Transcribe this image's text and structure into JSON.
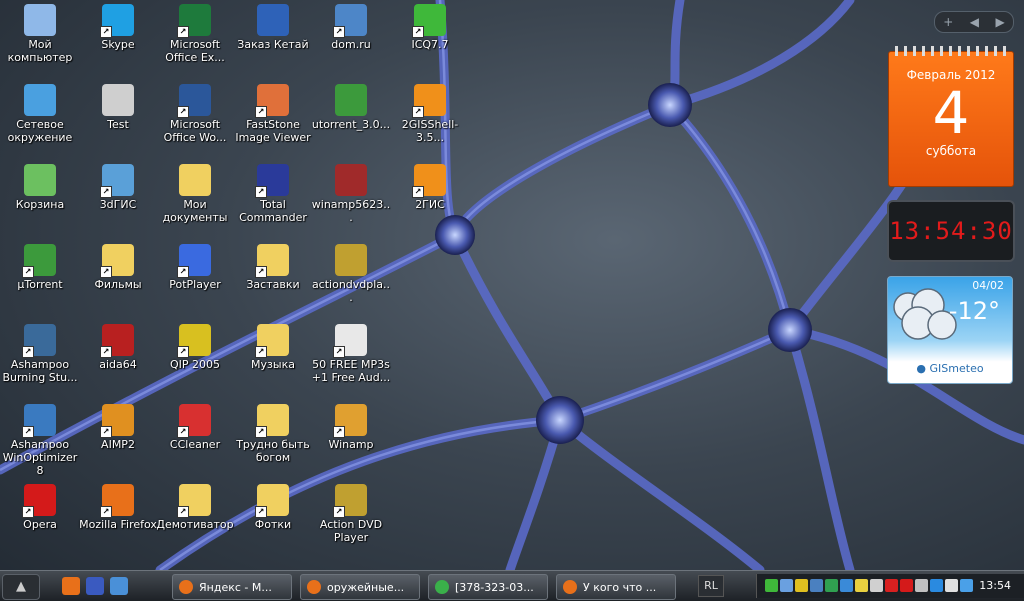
{
  "desktop": {
    "icons": [
      {
        "id": "my-computer",
        "label": "Мой компьютер",
        "icon": "computer-icon",
        "color": "#8fb8e8",
        "col": 0,
        "row": 0,
        "shortcut": false
      },
      {
        "id": "skype",
        "label": "Skype",
        "icon": "skype-icon",
        "color": "#1fa0e3",
        "col": 1,
        "row": 0,
        "shortcut": true
      },
      {
        "id": "excel",
        "label": "Microsoft Office Ex...",
        "icon": "excel-icon",
        "color": "#1e7a3c",
        "col": 2,
        "row": 0,
        "shortcut": true
      },
      {
        "id": "zakaz",
        "label": "Заказ Кетай",
        "icon": "word-doc-icon",
        "color": "#2e62b8",
        "col": 3,
        "row": 0,
        "shortcut": false
      },
      {
        "id": "domru",
        "label": "dom.ru",
        "icon": "network-globe-icon",
        "color": "#4d86c8",
        "col": 4,
        "row": 0,
        "shortcut": true
      },
      {
        "id": "icq",
        "label": "ICQ7.7",
        "icon": "icq-flower-icon",
        "color": "#3fb83a",
        "col": 5,
        "row": 0,
        "shortcut": true
      },
      {
        "id": "network",
        "label": "Сетевое окружение",
        "icon": "network-icon",
        "color": "#4aa0e0",
        "col": 0,
        "row": 1,
        "shortcut": false
      },
      {
        "id": "test",
        "label": "Test",
        "icon": "device-icon",
        "color": "#cfcfcf",
        "col": 1,
        "row": 1,
        "shortcut": false
      },
      {
        "id": "word",
        "label": "Microsoft Office Wo...",
        "icon": "word-icon",
        "color": "#2b579a",
        "col": 2,
        "row": 1,
        "shortcut": true
      },
      {
        "id": "faststone",
        "label": "FastStone Image Viewer",
        "icon": "eye-icon",
        "color": "#e0703a",
        "col": 3,
        "row": 1,
        "shortcut": true
      },
      {
        "id": "utorrent30",
        "label": "utorrent_3.0...",
        "icon": "utorrent-icon",
        "color": "#3c9a3c",
        "col": 4,
        "row": 1,
        "shortcut": false
      },
      {
        "id": "2gisshell",
        "label": "2GISShell-3.5...",
        "icon": "2gis-icon",
        "color": "#f0901a",
        "col": 5,
        "row": 1,
        "shortcut": true
      },
      {
        "id": "recycle",
        "label": "Корзина",
        "icon": "recycle-bin-icon",
        "color": "#6cc060",
        "col": 0,
        "row": 2,
        "shortcut": false
      },
      {
        "id": "3dgis",
        "label": "3dГИС",
        "icon": "3dgis-icon",
        "color": "#5aa0d8",
        "col": 1,
        "row": 2,
        "shortcut": true
      },
      {
        "id": "mydocs",
        "label": "Мои документы",
        "icon": "documents-folder-icon",
        "color": "#f0d060",
        "col": 2,
        "row": 2,
        "shortcut": false
      },
      {
        "id": "totalcmd",
        "label": "Total Commander",
        "icon": "floppy-icon",
        "color": "#2a3a9a",
        "col": 3,
        "row": 2,
        "shortcut": true
      },
      {
        "id": "winamp5623",
        "label": "winamp5623...",
        "icon": "winrar-icon",
        "color": "#a02a2a",
        "col": 4,
        "row": 2,
        "shortcut": false
      },
      {
        "id": "2gis",
        "label": "2ГИС",
        "icon": "2gis-icon",
        "color": "#f0901a",
        "col": 5,
        "row": 2,
        "shortcut": true
      },
      {
        "id": "utorrent",
        "label": "µTorrent",
        "icon": "utorrent-icon",
        "color": "#3c9a3c",
        "col": 0,
        "row": 3,
        "shortcut": true
      },
      {
        "id": "filmy",
        "label": "Фильмы",
        "icon": "folder-icon",
        "color": "#f0d060",
        "col": 1,
        "row": 3,
        "shortcut": true
      },
      {
        "id": "potplayer",
        "label": "PotPlayer",
        "icon": "potplayer-icon",
        "color": "#3a6ae0",
        "col": 2,
        "row": 3,
        "shortcut": true
      },
      {
        "id": "zastavki",
        "label": "Заставки",
        "icon": "folder-icon",
        "color": "#f0d060",
        "col": 3,
        "row": 3,
        "shortcut": true
      },
      {
        "id": "actiondvdpla",
        "label": "actiondvdpla...",
        "icon": "dvd-icon",
        "color": "#c0a030",
        "col": 4,
        "row": 3,
        "shortcut": false
      },
      {
        "id": "ashampoo-burning",
        "label": "Ashampoo Burning Stu...",
        "icon": "ashampoo-burning-icon",
        "color": "#3a6a9a",
        "col": 0,
        "row": 4,
        "shortcut": true
      },
      {
        "id": "aida64",
        "label": "aida64",
        "icon": "aida64-icon",
        "color": "#b82020",
        "col": 1,
        "row": 4,
        "shortcut": true
      },
      {
        "id": "qip",
        "label": "QIP 2005",
        "icon": "qip-icon",
        "color": "#d8c020",
        "col": 2,
        "row": 4,
        "shortcut": true
      },
      {
        "id": "muzyka",
        "label": "Музыка",
        "icon": "folder-icon",
        "color": "#f0d060",
        "col": 3,
        "row": 4,
        "shortcut": true
      },
      {
        "id": "50free",
        "label": "50 FREE MP3s +1 Free Aud...",
        "icon": "dotted-disc-icon",
        "color": "#e8e8e8",
        "col": 4,
        "row": 4,
        "shortcut": true
      },
      {
        "id": "ashampoo-win",
        "label": "Ashampoo WinOptimizer 8",
        "icon": "ashampoo-winoptimizer-icon",
        "color": "#3a7ac0",
        "col": 0,
        "row": 5,
        "shortcut": true
      },
      {
        "id": "aimp2",
        "label": "AIMP2",
        "icon": "aimp-icon",
        "color": "#e09020",
        "col": 1,
        "row": 5,
        "shortcut": true
      },
      {
        "id": "ccleaner",
        "label": "CCleaner",
        "icon": "ccleaner-icon",
        "color": "#d83030",
        "col": 2,
        "row": 5,
        "shortcut": true
      },
      {
        "id": "trudno",
        "label": "Трудно быть богом",
        "icon": "folder-icon",
        "color": "#f0d060",
        "col": 3,
        "row": 5,
        "shortcut": true
      },
      {
        "id": "winamp",
        "label": "Winamp",
        "icon": "winamp-icon",
        "color": "#e0a030",
        "col": 4,
        "row": 5,
        "shortcut": true
      },
      {
        "id": "opera",
        "label": "Opera",
        "icon": "opera-icon",
        "color": "#d41a1a",
        "col": 0,
        "row": 6,
        "shortcut": true
      },
      {
        "id": "firefox",
        "label": "Mozilla Firefox",
        "icon": "firefox-icon",
        "color": "#e8701a",
        "col": 1,
        "row": 6,
        "shortcut": true
      },
      {
        "id": "demotivator",
        "label": "Демотиватор",
        "icon": "folder-icon",
        "color": "#f0d060",
        "col": 2,
        "row": 6,
        "shortcut": true
      },
      {
        "id": "fotki",
        "label": "Фотки",
        "icon": "folder-icon",
        "color": "#f0d060",
        "col": 3,
        "row": 6,
        "shortcut": true
      },
      {
        "id": "actiondvd",
        "label": "Action DVD Player",
        "icon": "dvd-icon",
        "color": "#c0a030",
        "col": 4,
        "row": 6,
        "shortcut": true
      }
    ]
  },
  "gadgets": {
    "toolbar": {
      "add": "+",
      "prev": "◀",
      "next": "▶"
    },
    "calendar": {
      "month": "Февраль 2012",
      "day": "4",
      "weekday": "суббота"
    },
    "clock": {
      "time": "13:54:30"
    },
    "weather": {
      "date": "04/02",
      "temp": "-12°",
      "brand": "GISmeteo"
    }
  },
  "taskbar": {
    "quick_launch": [
      {
        "name": "firefox-icon",
        "color": "#e8701a"
      },
      {
        "name": "save-icon",
        "color": "#3a5ac0"
      },
      {
        "name": "ie-icon",
        "color": "#4a90d8"
      }
    ],
    "tasks": [
      {
        "label": "Яндекс - М...",
        "icon": "firefox-icon",
        "color": "#e8701a"
      },
      {
        "label": "оружейные...",
        "icon": "firefox-icon",
        "color": "#e8701a"
      },
      {
        "label": "[378-323-03...",
        "icon": "excel-icon",
        "color": "#3ab04a"
      },
      {
        "label": "У кого что ...",
        "icon": "firefox-icon",
        "color": "#e8701a"
      }
    ],
    "language": "RL",
    "tray_icons": [
      {
        "name": "icq-tray-icon",
        "color": "#3fb83a"
      },
      {
        "name": "network-tray-icon",
        "color": "#6aa0e0"
      },
      {
        "name": "shield-tray-icon",
        "color": "#e0c020"
      },
      {
        "name": "monitor-tray-icon",
        "color": "#4a80c0"
      },
      {
        "name": "antivirus-tray-icon",
        "color": "#30a050"
      },
      {
        "name": "sync-tray-icon",
        "color": "#3a8ad8"
      },
      {
        "name": "warning-tray-icon",
        "color": "#e8d040"
      },
      {
        "name": "volume-tray-icon",
        "color": "#d0d0d0"
      },
      {
        "name": "red-arrow-tray-icon",
        "color": "#d82020"
      },
      {
        "name": "opera-tray-icon",
        "color": "#d41a1a"
      },
      {
        "name": "settings-tray-icon",
        "color": "#c0c0c0"
      },
      {
        "name": "power-tray-icon",
        "color": "#2a8ae0"
      },
      {
        "name": "sound-tray-icon",
        "color": "#e0e0e0"
      },
      {
        "name": "display-tray-icon",
        "color": "#4aa0e8"
      }
    ],
    "time": "13:54"
  }
}
